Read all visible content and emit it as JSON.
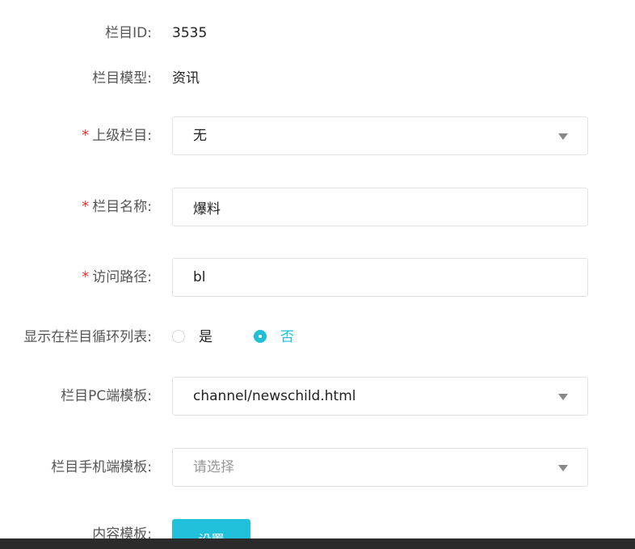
{
  "form": {
    "column_id": {
      "label": "栏目ID:",
      "value": "3535"
    },
    "column_model": {
      "label": "栏目模型:",
      "value": "资讯"
    },
    "parent_column": {
      "required_mark": "*",
      "label": "上级栏目:",
      "value": "无"
    },
    "column_name": {
      "required_mark": "*",
      "label": "栏目名称:",
      "value": "爆料"
    },
    "access_path": {
      "required_mark": "*",
      "label": "访问路径:",
      "value": "bl"
    },
    "show_in_loop": {
      "label": "显示在栏目循环列表:",
      "options": [
        {
          "label": "是",
          "checked": false
        },
        {
          "label": "否",
          "checked": true
        }
      ]
    },
    "pc_template": {
      "label": "栏目PC端模板:",
      "value": "channel/newschild.html"
    },
    "mobile_template": {
      "label": "栏目手机端模板:",
      "placeholder": "请选择"
    },
    "content_template": {
      "label": "内容模板:",
      "button_label": "设置"
    }
  },
  "colors": {
    "accent": "#22c1db",
    "required": "#e8312f",
    "border": "#e2e2e2"
  },
  "icons": {
    "select_caret": "chevron-down-icon",
    "radio": "radio-icon"
  }
}
